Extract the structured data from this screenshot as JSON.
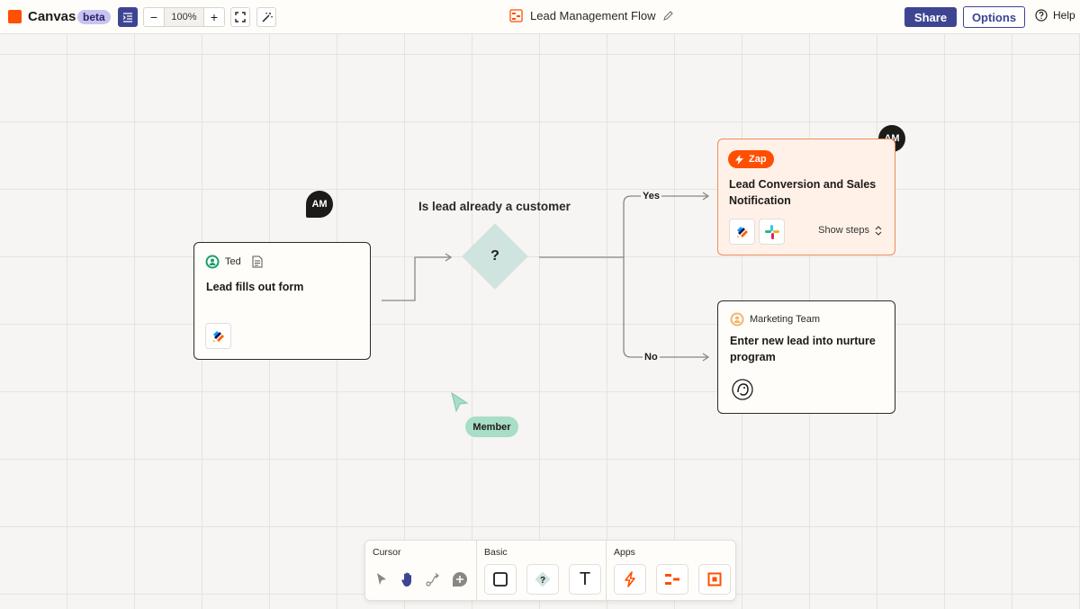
{
  "topbar": {
    "app_name": "Canvas",
    "beta_label": "beta",
    "zoom_level": "100%",
    "zoom_out": "−",
    "zoom_in": "+",
    "flow_title": "Lead Management Flow",
    "share_label": "Share",
    "options_label": "Options",
    "help_label": "Help"
  },
  "canvas": {
    "collaborator_initials": "AM",
    "trigger_card": {
      "owner": "Ted",
      "title": "Lead fills out form",
      "app_icon": "jotform-icon"
    },
    "decision": {
      "label": "Is lead already a customer",
      "symbol": "?",
      "yes_label": "Yes",
      "no_label": "No"
    },
    "zap_card": {
      "badge": "Zap",
      "title_line1": "Lead Conversion and Sales",
      "title_line2": "Notification",
      "app_icons": [
        "jotform-icon",
        "slack-icon"
      ],
      "show_steps_label": "Show steps"
    },
    "nurture_card": {
      "owner": "Marketing Team",
      "title_line1": "Enter new lead into nurture",
      "title_line2": "program",
      "app_icon": "mailchimp-icon"
    },
    "cursor_label": "Member"
  },
  "toolbar": {
    "sections": [
      {
        "label": "Cursor"
      },
      {
        "label": "Basic"
      },
      {
        "label": "Apps"
      }
    ],
    "text_tool_glyph": "T"
  },
  "colors": {
    "brand": "#ff4f00",
    "primary": "#3d4592",
    "decision_fill": "#cfe3df",
    "zap_card_fill": "#fff1e8",
    "member_badge": "#a8ddc6"
  }
}
